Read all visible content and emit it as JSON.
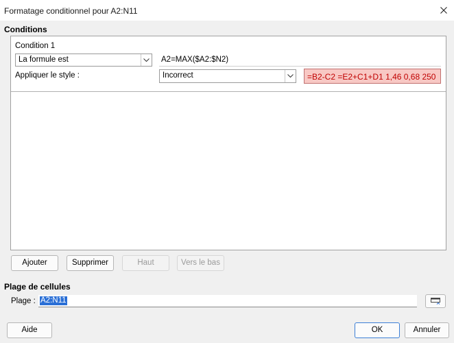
{
  "window": {
    "title": "Formatage conditionnel pour A2:N11"
  },
  "conditions": {
    "section_label": "Conditions",
    "condition1": {
      "title": "Condition 1",
      "type_value": "La formule est",
      "formula": "A2=MAX($A2:$N2)",
      "apply_label": "Appliquer le style :",
      "style_value": "Incorrect",
      "preview_text": "=B2-C2  =E2+C1+D1   1,46 0,68 250",
      "preview_bg": "#f8c8c4",
      "preview_fg": "#c00000"
    }
  },
  "buttons": {
    "add": "Ajouter",
    "remove": "Supprimer",
    "up": "Haut",
    "down": "Vers le bas",
    "help": "Aide",
    "ok": "OK",
    "cancel": "Annuler"
  },
  "range": {
    "section_label": "Plage de cellules",
    "label": "Plage :",
    "value": "A2:N11"
  },
  "icons": {
    "close": "close-icon",
    "chevron": "chevron-down-icon",
    "shrink": "shrink-dialog-icon"
  }
}
